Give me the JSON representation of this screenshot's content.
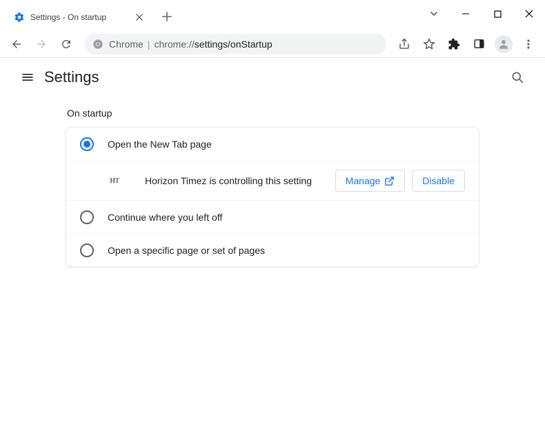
{
  "window": {
    "tab_title": "Settings - On startup"
  },
  "omnibox": {
    "scheme_label": "Chrome",
    "url_host": "chrome://",
    "url_path": "settings/onStartup"
  },
  "header": {
    "title": "Settings"
  },
  "section": {
    "title": "On startup",
    "options": {
      "new_tab": "Open the New Tab page",
      "continue": "Continue where you left off",
      "specific": "Open a specific page or set of pages"
    },
    "extension": {
      "icon_text": "HT",
      "message": "Horizon Timez is controlling this setting",
      "manage": "Manage",
      "disable": "Disable"
    }
  }
}
